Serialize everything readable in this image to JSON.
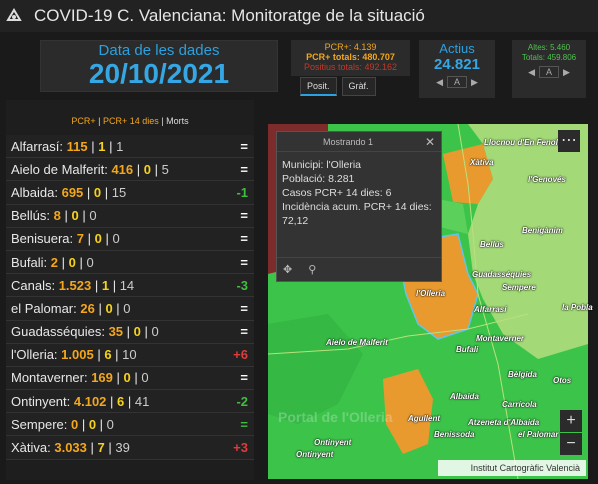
{
  "header": {
    "title": "COVID-19 C. Valenciana: Monitoratge de la situació"
  },
  "date_panel": {
    "label": "Data de les dades",
    "value": "20/10/2021"
  },
  "pcr_panel": {
    "line1": "PCR+: 4.139",
    "line2": "PCR+ totals: 480.707",
    "line3": "Positius totals: 492.162"
  },
  "tabs": [
    {
      "label": "Posit."
    },
    {
      "label": "Gràf."
    }
  ],
  "actius": {
    "label": "Actius",
    "value": "24.821",
    "pager_mid": "A"
  },
  "altes": {
    "line1": "Altes: 5.460",
    "line2": "Totals: 459.806",
    "pager_mid": "A"
  },
  "list": {
    "header_a": "PCR+",
    "header_sep1": " | ",
    "header_b": "PCR+ 14 dies",
    "header_sep2": " | ",
    "header_c": "Morts",
    "rows": [
      {
        "name": "Alfarrasí: ",
        "pcr": "115",
        "pcr14": "1",
        "morts": "1",
        "trend": "=",
        "trend_color": "#ffffff"
      },
      {
        "name": "Aielo de Malferit: ",
        "pcr": "416",
        "pcr14": "0",
        "morts": "5",
        "trend": "=",
        "trend_color": "#ffffff"
      },
      {
        "name": "Albaida: ",
        "pcr": "695",
        "pcr14": "0",
        "morts": "15",
        "trend": "-1",
        "trend_color": "#3fbf3f"
      },
      {
        "name": "Bellús: ",
        "pcr": "8",
        "pcr14": "0",
        "morts": "0",
        "trend": "=",
        "trend_color": "#ffffff"
      },
      {
        "name": "Benisuera: ",
        "pcr": "7",
        "pcr14": "0",
        "morts": "0",
        "trend": "=",
        "trend_color": "#ffffff"
      },
      {
        "name": "Bufali: ",
        "pcr": "2",
        "pcr14": "0",
        "morts": "0",
        "trend": "=",
        "trend_color": "#ffffff"
      },
      {
        "name": "Canals: ",
        "pcr": "1.523",
        "pcr14": "1",
        "morts": "14",
        "trend": "-3",
        "trend_color": "#3fbf3f"
      },
      {
        "name": "el Palomar: ",
        "pcr": "26",
        "pcr14": "0",
        "morts": "0",
        "trend": "=",
        "trend_color": "#ffffff"
      },
      {
        "name": "Guadasséquies: ",
        "pcr": "35",
        "pcr14": "0",
        "morts": "0",
        "trend": "=",
        "trend_color": "#ffffff"
      },
      {
        "name": "l'Olleria: ",
        "pcr": "1.005",
        "pcr14": "6",
        "morts": "10",
        "trend": "+6",
        "trend_color": "#e03b3b"
      },
      {
        "name": "Montaverner: ",
        "pcr": "169",
        "pcr14": "0",
        "morts": "0",
        "trend": "=",
        "trend_color": "#ffffff"
      },
      {
        "name": "Ontinyent: ",
        "pcr": "4.102",
        "pcr14": "6",
        "morts": "41",
        "trend": "-2",
        "trend_color": "#3fbf3f"
      },
      {
        "name": "Sempere: ",
        "pcr": "0",
        "pcr14": "0",
        "morts": "0",
        "trend": "=",
        "trend_color": "#3fbf3f"
      },
      {
        "name": "Xàtiva: ",
        "pcr": "3.033",
        "pcr14": "7",
        "morts": "39",
        "trend": "+3",
        "trend_color": "#e03b3b"
      }
    ]
  },
  "popup": {
    "title": "Mostrando 1",
    "municipi": "Municipi: l'Olleria",
    "poblacio": "Població: 8.281",
    "casos": "Casos PCR+ 14 dies: 6",
    "incidencia": "Incidència acum. PCR+ 14 dies: 72,12"
  },
  "map": {
    "attribution": "Institut Cartogràfic Valencià",
    "watermark": "Portal de l'Olleria",
    "towns": [
      {
        "name": "Llocnou d'En Fenollet",
        "key": "llocnou"
      },
      {
        "name": "Xàtiva",
        "key": "xativa"
      },
      {
        "name": "l'Genovés",
        "key": "genoves"
      },
      {
        "name": "Benigànim",
        "key": "beniganim"
      },
      {
        "name": "Bellús",
        "key": "bellus"
      },
      {
        "name": "Guadasséquies",
        "key": "guadassequies"
      },
      {
        "name": "Sempere",
        "key": "sempere"
      },
      {
        "name": "l'Olleria",
        "key": "olleria"
      },
      {
        "name": "Alfarrasí",
        "key": "alfarrasi"
      },
      {
        "name": "la Pobla",
        "key": "pobla"
      },
      {
        "name": "Aielo de Malferit",
        "key": "aielo"
      },
      {
        "name": "Montaverner",
        "key": "montaverner"
      },
      {
        "name": "Bufali",
        "key": "bufali"
      },
      {
        "name": "Bèlgida",
        "key": "belgida"
      },
      {
        "name": "Otos",
        "key": "otos"
      },
      {
        "name": "Albaida",
        "key": "albaida"
      },
      {
        "name": "Agullent",
        "key": "agullent"
      },
      {
        "name": "Carrícola",
        "key": "carricola"
      },
      {
        "name": "Atzeneta d'Albaida",
        "key": "atzeneta"
      },
      {
        "name": "Benissoda",
        "key": "benissoda"
      },
      {
        "name": "el Palomar",
        "key": "palomar"
      },
      {
        "name": "Ontinyent",
        "key": "ontinyent1"
      },
      {
        "name": "Ontinyent",
        "key": "ontinyent2"
      }
    ]
  },
  "colors": {
    "accent": "#2aa1e0",
    "orange": "#f4a71d",
    "green": "#3cc34a",
    "dark_red": "#7a2a2a"
  }
}
